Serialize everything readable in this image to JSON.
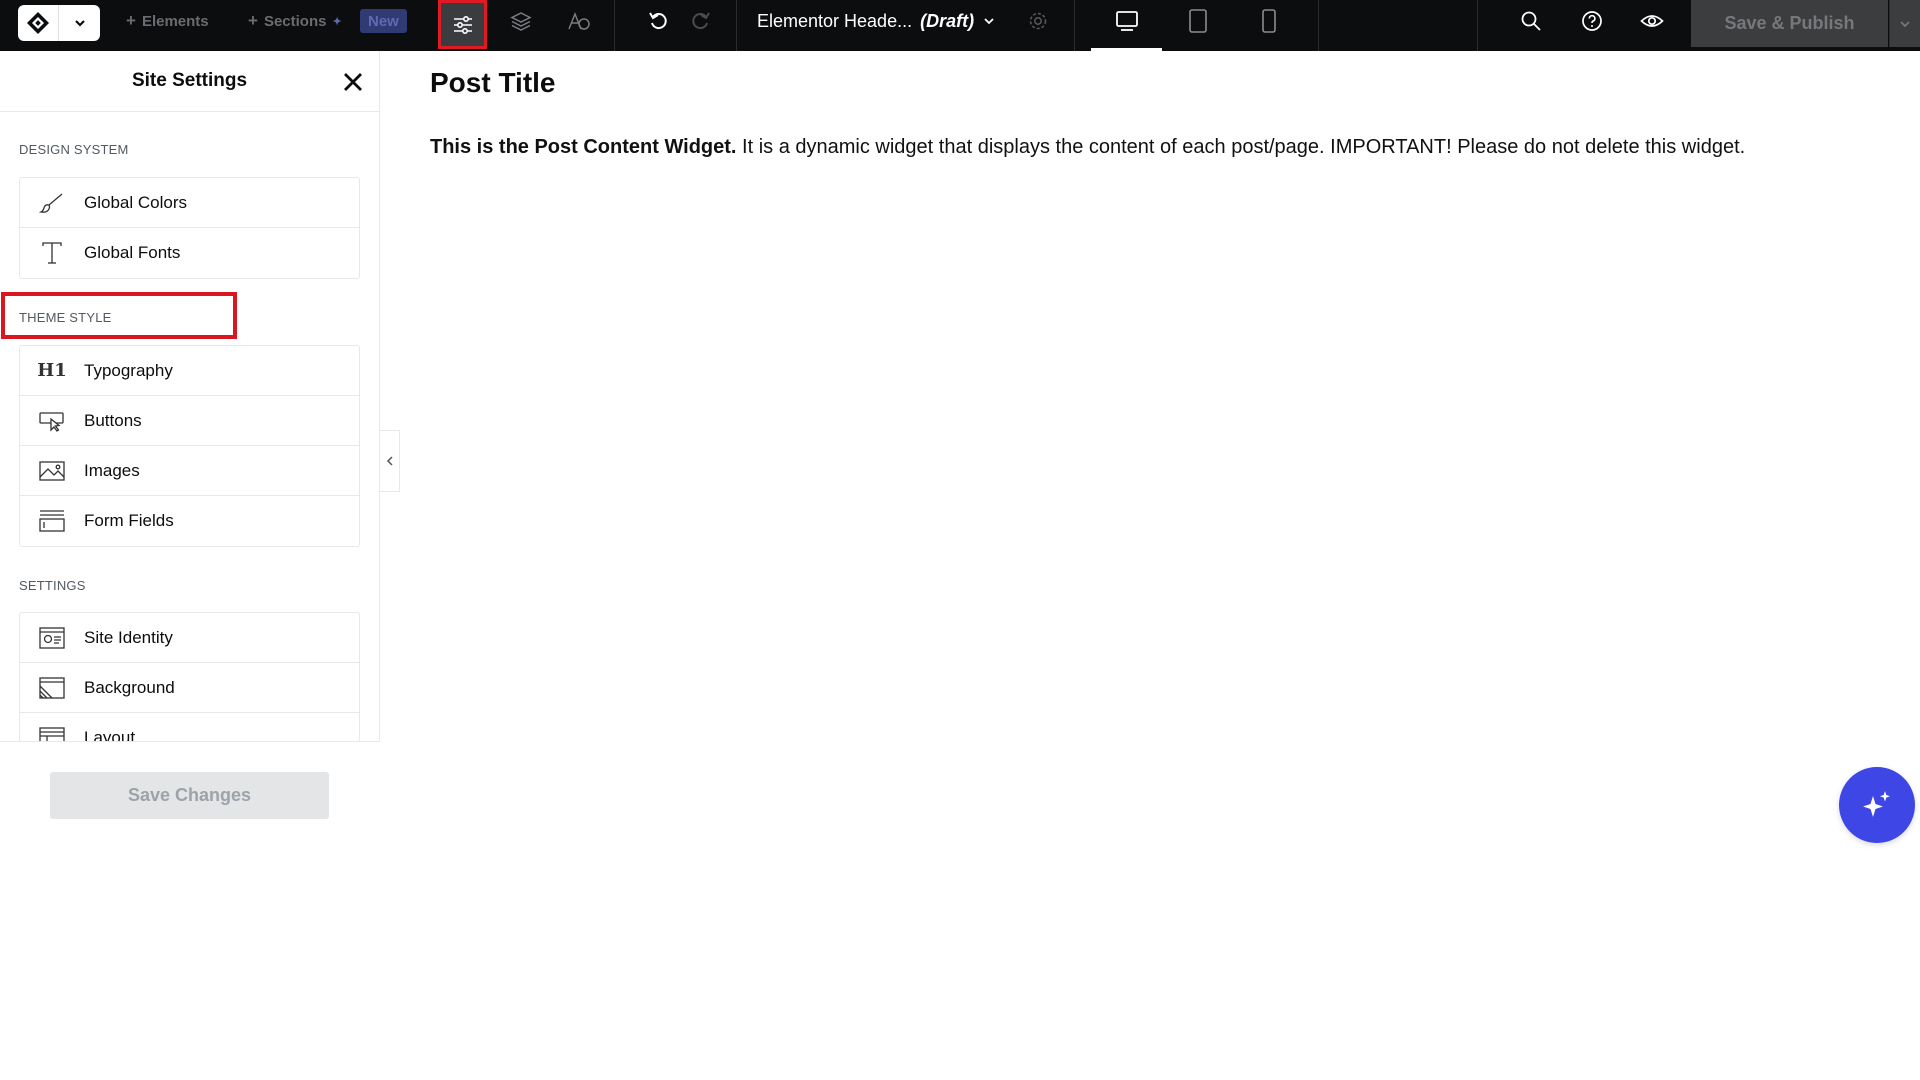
{
  "topbar": {
    "elements_label": "Elements",
    "sections_label": "Sections",
    "new_badge": "New",
    "doc_title": "Elementor Heade...",
    "doc_status": "(Draft)",
    "publish_label": "Save & Publish"
  },
  "panel": {
    "title": "Site Settings",
    "design_system_label": "DESIGN SYSTEM",
    "design_system_items": [
      "Global Colors",
      "Global Fonts"
    ],
    "theme_style_label": "THEME STYLE",
    "theme_style_items": [
      "Typography",
      "Buttons",
      "Images",
      "Form Fields"
    ],
    "settings_label": "SETTINGS",
    "settings_items": [
      "Site Identity",
      "Background",
      "Layout"
    ],
    "save_changes_label": "Save Changes"
  },
  "canvas": {
    "post_title": "Post Title",
    "content_bold": "This is the Post Content Widget.",
    "content_rest": " It is a dynamic widget that displays the content of each post/page. IMPORTANT! Please do not delete this widget."
  },
  "colors": {
    "topbar_bg": "#0c0d0e",
    "highlight_red": "#d8171e",
    "ai_button": "#3e46e6"
  },
  "icons": {
    "logo": "elementor-logo-icon",
    "site_settings": "sliders-icon",
    "structure": "layers-icon",
    "ai": "ai-sparkle-icon"
  }
}
